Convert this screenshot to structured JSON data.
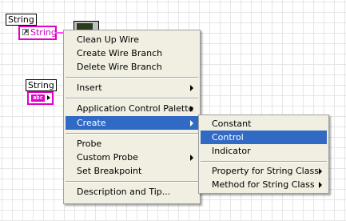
{
  "diagram": {
    "property_node_label": "String",
    "property_node_text": "String",
    "control_label": "String",
    "control_type_text": "abc"
  },
  "context_menu": {
    "items": [
      {
        "label": "Clean Up Wire"
      },
      {
        "label": "Create Wire Branch"
      },
      {
        "label": "Delete Wire Branch"
      },
      {
        "label": "Insert",
        "has_submenu": true
      },
      {
        "label": "Application Control Palette",
        "has_submenu": true
      },
      {
        "label": "Create",
        "has_submenu": true,
        "highlighted": true
      },
      {
        "label": "Probe"
      },
      {
        "label": "Custom Probe",
        "has_submenu": true
      },
      {
        "label": "Set Breakpoint"
      },
      {
        "label": "Description and Tip..."
      }
    ]
  },
  "create_submenu": {
    "items": [
      {
        "label": "Constant"
      },
      {
        "label": "Control",
        "highlighted": true
      },
      {
        "label": "Indicator"
      },
      {
        "label": "Property for String Class",
        "has_submenu": true
      },
      {
        "label": "Method for String Class",
        "has_submenu": true
      }
    ]
  },
  "colors": {
    "string_wire": "#ff4cff",
    "string_border": "#e000c8",
    "menu_bg": "#f1efe2",
    "highlight": "#316ac5"
  }
}
